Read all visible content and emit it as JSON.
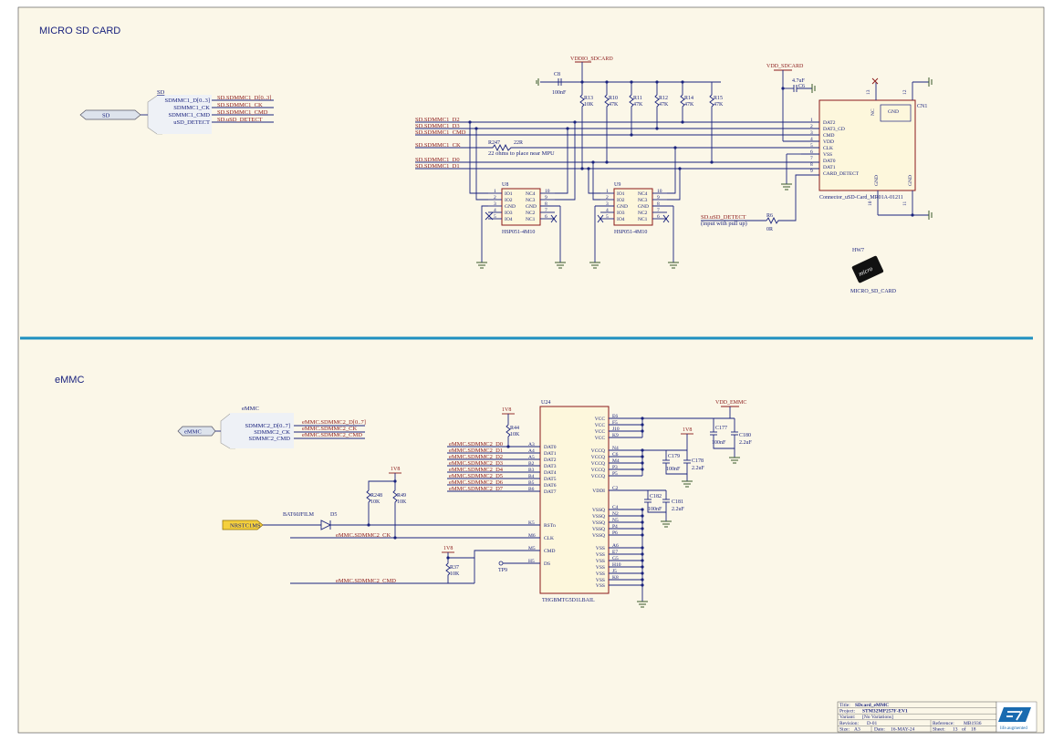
{
  "colors": {
    "paper": "#fbf7e8",
    "ink": "#1a237e",
    "net": "#8b1a1a",
    "divider": "#1e90c0",
    "chip_fill": "#fdf7dc",
    "logo": "#1a6bb0"
  },
  "sections": {
    "micro_sd_title": "MICRO SD CARD",
    "emmc_title": "eMMC"
  },
  "sd_block": {
    "title": "SD",
    "port_label": "SD",
    "pins": [
      "SDMMC1_D[0..3]",
      "SDMMC1_CK",
      "SDMMC1_CMD",
      "uSD_DETECT"
    ],
    "nets": [
      "SD.SDMMC1_D[0..3]",
      "SD.SDMMC1_CK",
      "SD.SDMMC1_CMD",
      "SD.uSD_DETECT"
    ]
  },
  "sd_nets_left": [
    "SD.SDMMC1_D2",
    "SD.SDMMC1_D3",
    "SD.SDMMC1_CMD",
    "SD.SDMMC1_CK",
    "SD.SDMMC1_D0",
    "SD.SDMMC1_D1"
  ],
  "sd_power": {
    "vddio": "VDDIO_SDCARD",
    "vdd": "VDD_SDCARD",
    "c8": "C8",
    "c8_val": "100nF",
    "c6": "C6",
    "c6_val": "4.7uF"
  },
  "pullups": [
    {
      "ref": "R13",
      "val": "10K"
    },
    {
      "ref": "R10",
      "val": "47K"
    },
    {
      "ref": "R11",
      "val": "47K"
    },
    {
      "ref": "R12",
      "val": "47K"
    },
    {
      "ref": "R14",
      "val": "47K"
    },
    {
      "ref": "R15",
      "val": "47K"
    }
  ],
  "r247": {
    "ref": "R247",
    "val": "22R",
    "note": "22 ohms to place near MPU"
  },
  "esd": [
    {
      "ref": "U8",
      "part": "HSP051-4M10"
    },
    {
      "ref": "U9",
      "part": "HSP051-4M10"
    }
  ],
  "esd_pins_left": [
    "IO1",
    "IO2",
    "GND",
    "IO3",
    "IO4"
  ],
  "esd_pins_right": [
    "NC4",
    "NC3",
    "GND",
    "NC2",
    "NC1"
  ],
  "esd_nums_left": [
    "1",
    "2",
    "3",
    "4",
    "5"
  ],
  "esd_nums_right": [
    "10",
    "9",
    "8",
    "7",
    "6"
  ],
  "detect": {
    "net": "SD.uSD_DETECT",
    "note": "(input with pull up)",
    "r6": "R6",
    "r6_val": "0R"
  },
  "connector": {
    "ref": "CN1",
    "part": "Connector_uSD-Card_MR01A-01211",
    "pin_names": [
      "DAT2",
      "DAT3_CD",
      "CMD",
      "VDD",
      "CLK",
      "VSS",
      "DAT0",
      "DAT1",
      "CARD_DETECT"
    ],
    "pin_nums": [
      "1",
      "2",
      "3",
      "4",
      "5",
      "6",
      "7",
      "8",
      "9"
    ],
    "nc_label": "NC",
    "gnd_label": "GND",
    "top_nums": [
      "13",
      "12"
    ],
    "bottom_nums": [
      "10",
      "11"
    ]
  },
  "hw7": {
    "ref": "HW7",
    "label": "MICRO_SD_CARD",
    "logo_text": "micro"
  },
  "emmc_block": {
    "title": "eMMC",
    "port_label": "eMMC",
    "pins": [
      "SDMMC2_D[0..7]",
      "SDMMC2_CK",
      "SDMMC2_CMD"
    ],
    "nets": [
      "eMMC.SDMMC2_D[0..7]",
      "eMMC.SDMMC2_CK",
      "eMMC.SDMMC2_CMD"
    ]
  },
  "u24": {
    "ref": "U24",
    "part": "THGBMTG5D1LBAIL",
    "left_pins": [
      "DAT0",
      "DAT1",
      "DAT2",
      "DAT3",
      "DAT4",
      "DAT5",
      "DAT6",
      "DAT7",
      "RSTn",
      "CLK",
      "CMD",
      "DS"
    ],
    "left_nums": [
      "A3",
      "A4",
      "A5",
      "B2",
      "B3",
      "B4",
      "B5",
      "B6",
      "K5",
      "M6",
      "M5",
      "H5"
    ],
    "right_pins": [
      "VCC",
      "VCC",
      "VCC",
      "VCC",
      "VCCQ",
      "VCCQ",
      "VCCQ",
      "VCCQ",
      "VCCQ",
      "VDDI",
      "VSSQ",
      "VSSQ",
      "VSSQ",
      "VSSQ",
      "VSSQ",
      "VSS",
      "VSS",
      "VSS",
      "VSS",
      "VSS",
      "VSS",
      "VSS"
    ],
    "right_nums": [
      "E6",
      "F5",
      "J10",
      "K9",
      "N4",
      "C6",
      "M4",
      "P3",
      "P5",
      "C2",
      "C4",
      "N2",
      "N5",
      "P4",
      "P6",
      "A6",
      "E7",
      "G5",
      "H10",
      "J5",
      "K8",
      ""
    ]
  },
  "emmc_nets": [
    "eMMC.SDMMC2_D0",
    "eMMC.SDMMC2_D1",
    "eMMC.SDMMC2_D2",
    "eMMC.SDMMC2_D3",
    "eMMC.SDMMC2_D4",
    "eMMC.SDMMC2_D5",
    "eMMC.SDMMC2_D6",
    "eMMC.SDMMC2_D7"
  ],
  "emmc_misc": {
    "v1v8": "1V8",
    "r44": "R44",
    "r44_val": "10K",
    "r248": "R248",
    "r248_val": "10K",
    "r49": "R49",
    "r49_val": "10K",
    "r37": "R37",
    "r37_val": "10K",
    "d5": "D5",
    "d5_part": "BAT60JFILM",
    "nrst": "NRSTC1MS",
    "ck_net": "eMMC.SDMMC2_CK",
    "cmd_net": "eMMC.SDMMC2_CMD",
    "tp9": "TP9",
    "vdd_emmc": "VDD_EMMC",
    "c177": "C177",
    "c177_val": "100nF",
    "c180": "C180",
    "c180_val": "2.2uF",
    "c179": "C179",
    "c179_val": "100nF",
    "c178": "C178",
    "c178_val": "2.2uF",
    "c182": "C182",
    "c182_val": "100nF",
    "c181": "C181",
    "c181_val": "2.2uF"
  },
  "title_block": {
    "title_label": "Title:",
    "title": "SDcard_eMMC",
    "project_label": "Project:",
    "project": "STM32MP257F-EV1",
    "variant_label": "Variant:",
    "variant": "[No Variations]",
    "revision_label": "Revision:",
    "revision": "D-01",
    "reference_label": "Reference:",
    "reference": "MB1936",
    "size_label": "Size:",
    "size": "A3",
    "date_label": "Date:",
    "date": "16-MAY-24",
    "sheet_label": "Sheet:",
    "sheet": "13",
    "sheet_of": "of",
    "sheet_total": "18",
    "logo_text": "life.augmented"
  }
}
